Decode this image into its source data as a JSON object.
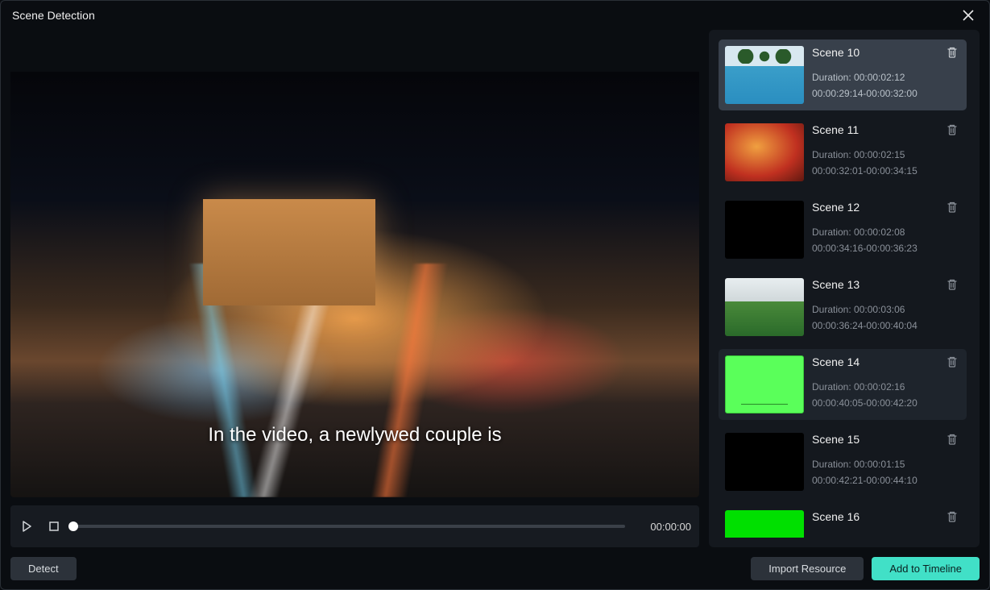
{
  "window": {
    "title": "Scene Detection"
  },
  "preview": {
    "caption": "In the video, a newlywed couple is",
    "timecode": "00:00:00"
  },
  "scenes": [
    {
      "name": "Scene 10",
      "duration": "Duration: 00:00:02:12",
      "range": "00:00:29:14-00:00:32:00",
      "thumb": "pool",
      "selected": true
    },
    {
      "name": "Scene 11",
      "duration": "Duration: 00:00:02:15",
      "range": "00:00:32:01-00:00:34:15",
      "thumb": "red"
    },
    {
      "name": "Scene 12",
      "duration": "Duration: 00:00:02:08",
      "range": "00:00:34:16-00:00:36:23",
      "thumb": "black"
    },
    {
      "name": "Scene 13",
      "duration": "Duration: 00:00:03:06",
      "range": "00:00:36:24-00:00:40:04",
      "thumb": "field"
    },
    {
      "name": "Scene 14",
      "duration": "Duration: 00:00:02:16",
      "range": "00:00:40:05-00:00:42:20",
      "thumb": "greenscreen",
      "hovered": true
    },
    {
      "name": "Scene 15",
      "duration": "Duration: 00:00:01:15",
      "range": "00:00:42:21-00:00:44:10",
      "thumb": "black"
    },
    {
      "name": "Scene 16",
      "duration": "",
      "range": "",
      "thumb": "brightgreen"
    }
  ],
  "buttons": {
    "detect": "Detect",
    "import": "Import Resource",
    "add": "Add to Timeline"
  }
}
